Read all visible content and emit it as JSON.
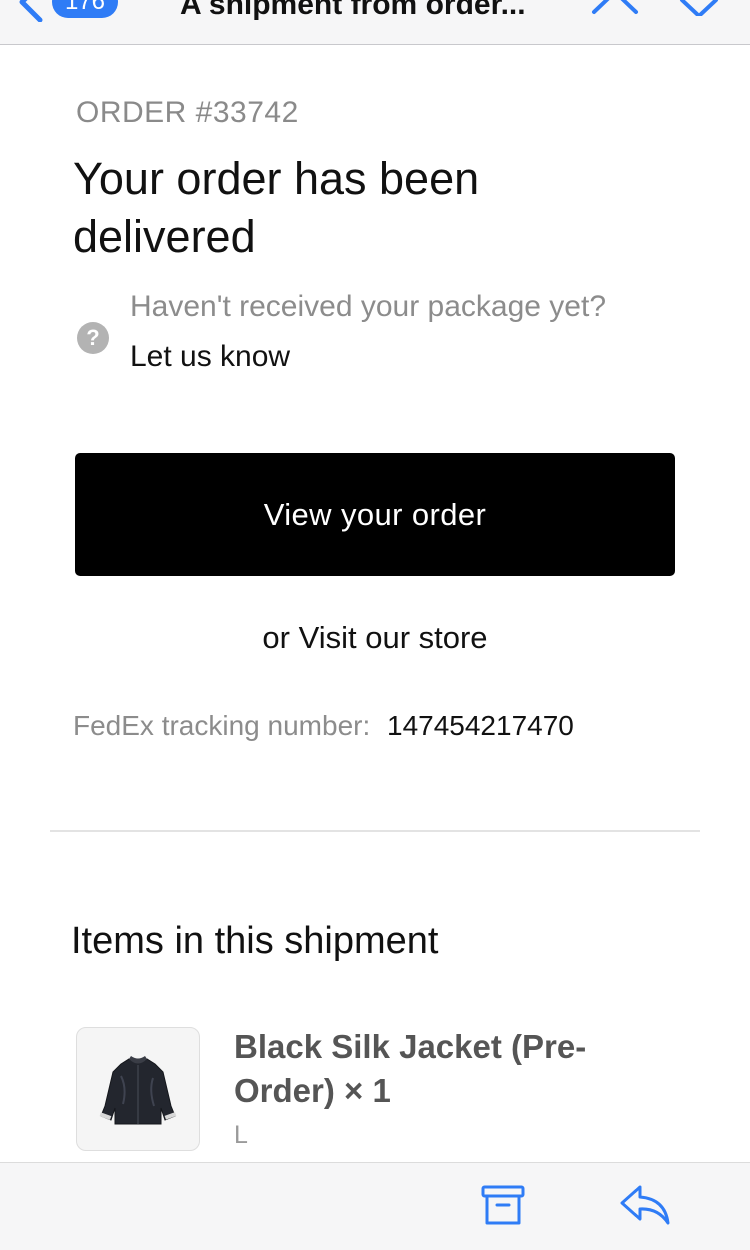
{
  "nav": {
    "message_count": "176",
    "subject": "A shipment from order..."
  },
  "email": {
    "order_number": "ORDER #33742",
    "headline": "Your order has been delivered",
    "help_question": "Haven't received your package yet?",
    "help_link": "Let us know",
    "view_order_label": "View your order",
    "visit_store_label": "or Visit our store",
    "tracking_label": "FedEx tracking number:",
    "tracking_number": "147454217470",
    "items_heading": "Items in this shipment",
    "items": [
      {
        "name": "Black Silk Jacket (Pre-Order) × 1",
        "variant": "L"
      }
    ]
  },
  "toolbar": {
    "archive_icon": "archive-icon",
    "reply_icon": "reply-icon"
  },
  "colors": {
    "accent": "#2f7cf6",
    "button_bg": "#000000",
    "muted_text": "#8c8c8c"
  }
}
